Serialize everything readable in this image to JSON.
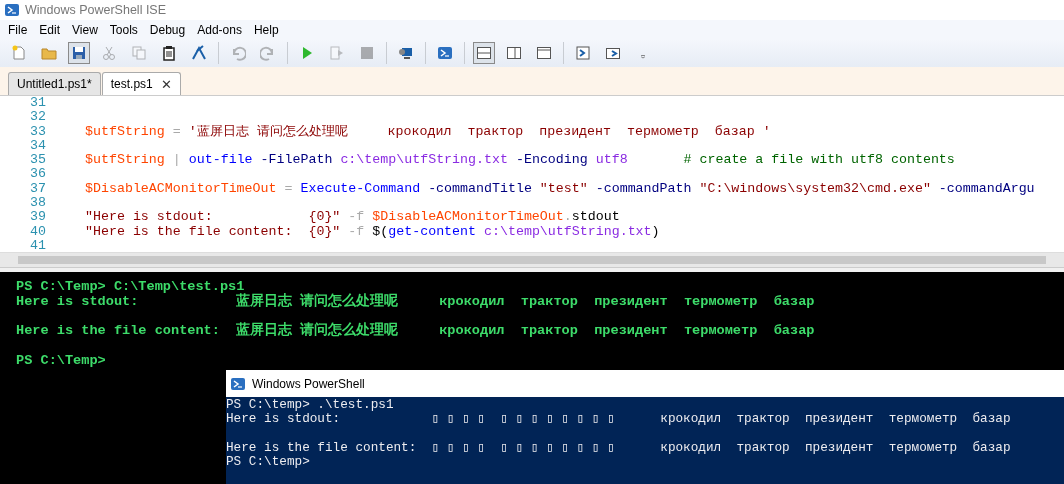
{
  "window": {
    "title": "Windows PowerShell ISE"
  },
  "menu": [
    "File",
    "Edit",
    "View",
    "Tools",
    "Debug",
    "Add-ons",
    "Help"
  ],
  "toolbar": [
    {
      "disabled": false,
      "pressed": false
    },
    {
      "disabled": false,
      "pressed": false
    },
    {
      "disabled": false,
      "pressed": true
    },
    {
      "disabled": true,
      "pressed": false
    },
    {
      "disabled": true,
      "pressed": false
    },
    {
      "disabled": false,
      "pressed": false
    },
    {
      "disabled": false,
      "pressed": false
    },
    {
      "disabled": true,
      "pressed": false
    },
    {
      "disabled": true,
      "pressed": false
    },
    {
      "disabled": false,
      "pressed": false
    },
    {
      "disabled": true,
      "pressed": false
    },
    {
      "disabled": true,
      "pressed": false
    },
    {
      "disabled": false,
      "pressed": false
    },
    {
      "disabled": false,
      "pressed": false
    },
    {
      "disabled": false,
      "pressed": true
    },
    {
      "disabled": false,
      "pressed": false
    },
    {
      "disabled": false,
      "pressed": false
    },
    {
      "disabled": false,
      "pressed": false
    },
    {
      "disabled": false,
      "pressed": false
    }
  ],
  "tabs": [
    {
      "label": "Untitled1.ps1*",
      "selected": false
    },
    {
      "label": "test.ps1",
      "selected": true,
      "close": "✕"
    }
  ],
  "editor": {
    "lines": [
      {
        "number": "31"
      },
      {
        "number": "32"
      },
      {
        "number": "33",
        "tokens": [
          {
            "kind": "variable",
            "text": "$utfString "
          },
          {
            "kind": "operator",
            "text": "= "
          },
          {
            "kind": "string",
            "text": "'蓝屏日志 请问怎么处理呢     крокодил  трактор  президент  термометр  базар '"
          }
        ]
      },
      {
        "number": "34"
      },
      {
        "number": "35",
        "tokens": [
          {
            "kind": "variable",
            "text": "$utfString "
          },
          {
            "kind": "operator",
            "text": "| "
          },
          {
            "kind": "command",
            "text": "out-file "
          },
          {
            "kind": "parameter",
            "text": "-FilePath "
          },
          {
            "kind": "argument",
            "text": "c:\\temp\\utfString.txt "
          },
          {
            "kind": "parameter",
            "text": "-Encoding "
          },
          {
            "kind": "argument",
            "text": "utf8       "
          },
          {
            "kind": "comment",
            "text": "# create a file with utf8 contents"
          }
        ]
      },
      {
        "number": "36"
      },
      {
        "number": "37",
        "tokens": [
          {
            "kind": "variable",
            "text": "$DisableACMonitorTimeOut "
          },
          {
            "kind": "operator",
            "text": "= "
          },
          {
            "kind": "command",
            "text": "Execute-Command "
          },
          {
            "kind": "parameter",
            "text": "-commandTitle "
          },
          {
            "kind": "string",
            "text": "\"test\" "
          },
          {
            "kind": "parameter",
            "text": "-commandPath "
          },
          {
            "kind": "string",
            "text": "\"C:\\windows\\system32\\cmd.exe\" "
          },
          {
            "kind": "parameter",
            "text": "-commandArgu"
          }
        ]
      },
      {
        "number": "38"
      },
      {
        "number": "39",
        "tokens": [
          {
            "kind": "string",
            "text": "\"Here is stdout:            {0}\" "
          },
          {
            "kind": "operator",
            "text": "-f "
          },
          {
            "kind": "variable",
            "text": "$DisableACMonitorTimeOut"
          },
          {
            "kind": "operator",
            "text": "."
          },
          {
            "kind": "plain",
            "text": "stdout"
          }
        ]
      },
      {
        "number": "40",
        "tokens": [
          {
            "kind": "string",
            "text": "\"Here is the file content:  {0}\" "
          },
          {
            "kind": "operator",
            "text": "-f "
          },
          {
            "kind": "plain",
            "text": "$("
          },
          {
            "kind": "command",
            "text": "get-content "
          },
          {
            "kind": "argument",
            "text": "c:\\temp\\utfString.txt"
          },
          {
            "kind": "plain",
            "text": ")"
          }
        ]
      },
      {
        "number": "41"
      }
    ]
  },
  "console": {
    "lines": [
      {
        "text": "PS C:\\Temp> C:\\Temp\\test.ps1",
        "space_before": false
      },
      {
        "text": "Here is stdout:            蓝屏日志 请问怎么处理呢     крокодил  трактор  президент  термометр  базар",
        "space_before": false
      },
      {
        "text": "Here is the file content:  蓝屏日志 请问怎么处理呢     крокодил  трактор  президент  термометр  базар",
        "space_before": true
      },
      {
        "text": "PS C:\\Temp>",
        "space_before": true
      }
    ]
  },
  "powershell_window": {
    "title": "Windows PowerShell",
    "lines": [
      {
        "text": "PS C:\\temp> .\\test.ps1",
        "space_before": false
      },
      {
        "text": "Here is stdout:            ▯ ▯ ▯ ▯  ▯ ▯ ▯ ▯ ▯ ▯ ▯ ▯      крокодил  трактор  президент  термометр  базар",
        "space_before": false
      },
      {
        "text": "Here is the file content:  ▯ ▯ ▯ ▯  ▯ ▯ ▯ ▯ ▯ ▯ ▯ ▯      крокодил  трактор  президент  термометр  базар",
        "space_before": true
      },
      {
        "text": "PS C:\\temp>",
        "space_before": false
      }
    ]
  }
}
